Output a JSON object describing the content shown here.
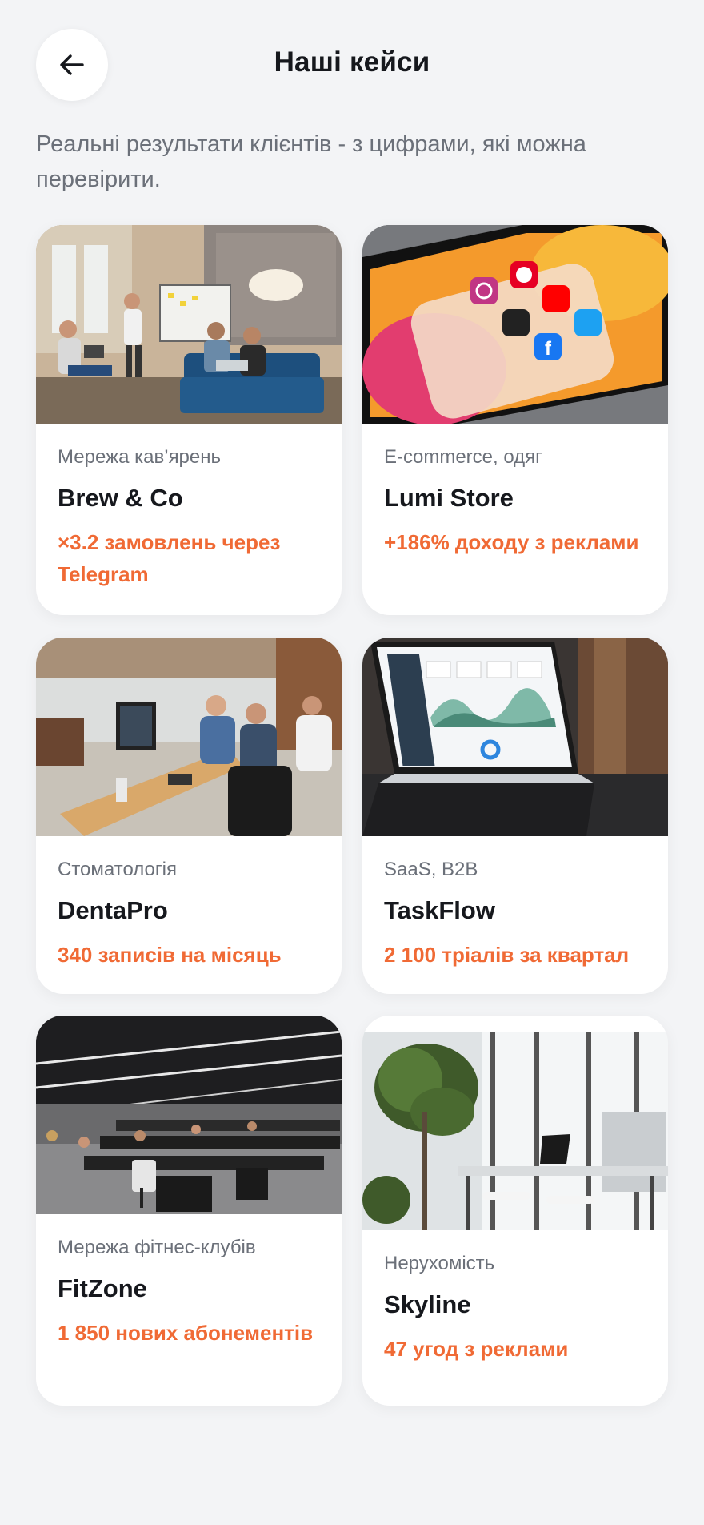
{
  "header": {
    "title": "Наші кейси",
    "back_icon": "arrow-left-icon"
  },
  "subtitle": "Реальні результати клієнтів - з цифрами, які можна перевірити.",
  "accent_color": "#f06a35",
  "cases": [
    {
      "category": "Мережа кав’ярень",
      "name": "Brew & Co",
      "result": "×3.2 замовлень через Telegram",
      "photo": "office-meeting-photo"
    },
    {
      "category": "E-commerce, одяг",
      "name": "Lumi Store",
      "result": "+186% доходу з реклами",
      "photo": "social-media-phone-photo"
    },
    {
      "category": "Стоматологія",
      "name": "DentaPro",
      "result": "340 записів на місяць",
      "photo": "team-desk-photo"
    },
    {
      "category": "SaaS, B2B",
      "name": "TaskFlow",
      "result": "2 100 тріалів за квартал",
      "photo": "laptop-dashboard-photo"
    },
    {
      "category": "Мережа фітнес-клубів",
      "name": "FitZone",
      "result": "1 850 нових абонементів",
      "photo": "open-office-photo"
    },
    {
      "category": "Нерухомість",
      "name": "Skyline",
      "result": "47 угод з реклами",
      "photo": "bright-workspace-photo"
    }
  ]
}
